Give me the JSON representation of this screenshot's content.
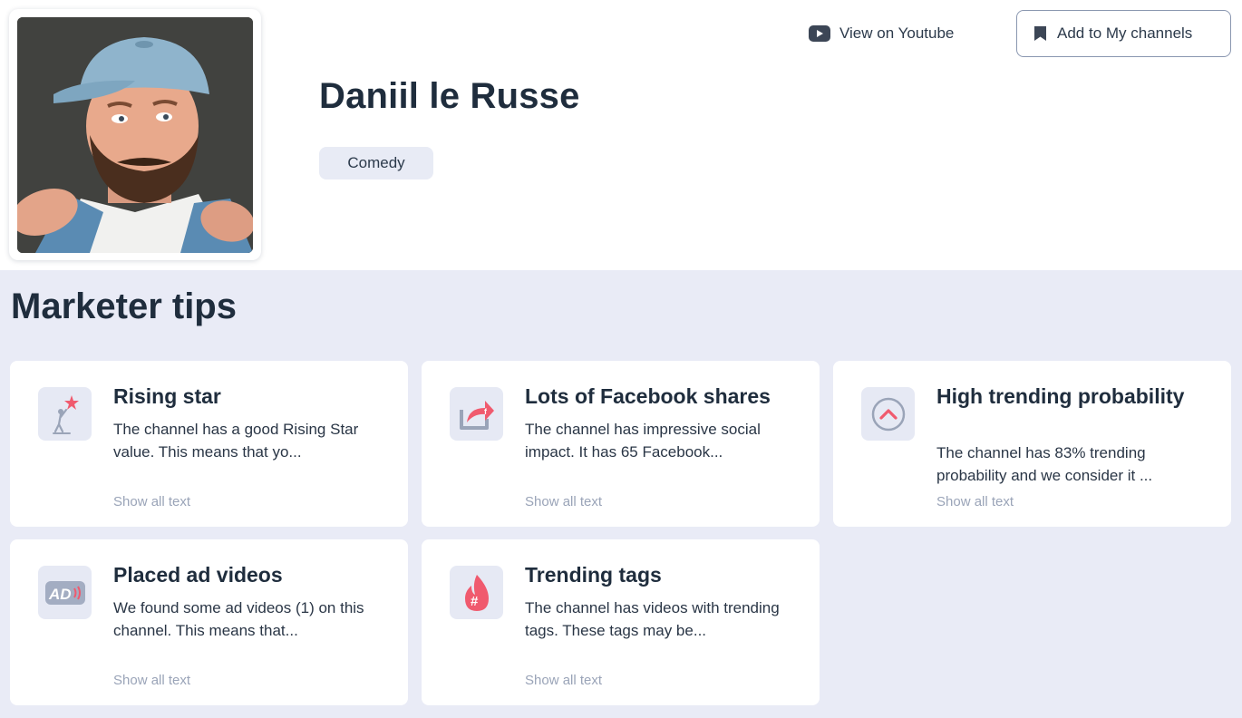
{
  "channel": {
    "name": "Daniil le Russe",
    "category": "Comedy",
    "avatar_icon": "channel-avatar-photo"
  },
  "actions": {
    "youtube_label": "View on Youtube",
    "youtube_icon": "youtube-icon",
    "add_label": "Add to My channels",
    "add_icon": "bookmark-icon"
  },
  "tips": {
    "title": "Marketer tips",
    "items": [
      {
        "title": "Rising star",
        "text": "The channel has a good Rising Star value. This means that yo...",
        "more": "Show all text",
        "icon": "rising-star-icon"
      },
      {
        "title": "Lots of Facebook shares",
        "text": "The channel has impressive social impact. It has 65 Facebook...",
        "more": "Show all text",
        "icon": "facebook-share-icon"
      },
      {
        "title": "High trending probability",
        "text": "The channel has 83% trending probability and we consider it ...",
        "more": "Show all text",
        "icon": "trending-up-icon"
      },
      {
        "title": "Placed ad videos",
        "text": "We found some ad videos (1) on this channel. This means that...",
        "more": "Show all text",
        "icon": "ad-icon"
      },
      {
        "title": "Trending tags",
        "text": "The channel has videos with trending tags. These tags may be...",
        "more": "Show all text",
        "icon": "hashtag-flame-icon"
      }
    ]
  },
  "colors": {
    "accent": "#f05a6e",
    "section_bg": "#e9ebf6",
    "muted_text": "#9aa4b8"
  }
}
